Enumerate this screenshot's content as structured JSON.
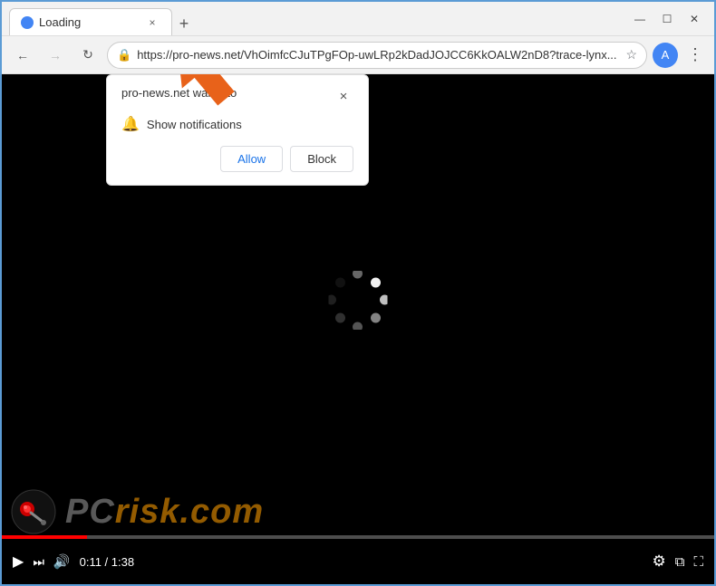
{
  "browser": {
    "title": "Loading",
    "tab_close": "×",
    "new_tab": "+",
    "window_minimize": "—",
    "window_maximize": "☐",
    "window_close": "✕"
  },
  "nav": {
    "back": "←",
    "forward": "→",
    "refresh": "↻",
    "url": "https://pro-news.net/VhOimfcCJuTPgFOp-uwLRp2kDadJOJCC6KkOALW2nD8?trace-lynx...",
    "star": "☆",
    "profile_letter": "A",
    "menu": "⋮"
  },
  "popup": {
    "title": "pro-news.net wants to",
    "close": "×",
    "notification_text": "Show notifications",
    "allow_label": "Allow",
    "block_label": "Block"
  },
  "video": {
    "time_current": "0:11",
    "time_total": "1:38",
    "time_display": "0:11 / 1:38",
    "progress_percent": 12
  },
  "pcrisk": {
    "text_pc": "PC",
    "text_risk": "risk.com"
  },
  "spinner": {
    "dots": [
      {
        "angle": 0,
        "opacity": 1.0,
        "color": "#ffffff"
      },
      {
        "angle": 45,
        "opacity": 0.85,
        "color": "#dddddd"
      },
      {
        "angle": 90,
        "opacity": 0.7,
        "color": "#bbbbbb"
      },
      {
        "angle": 135,
        "opacity": 0.55,
        "color": "#999999"
      },
      {
        "angle": 180,
        "opacity": 0.4,
        "color": "#777777"
      },
      {
        "angle": 225,
        "opacity": 0.3,
        "color": "#666666"
      },
      {
        "angle": 270,
        "opacity": 0.2,
        "color": "#555555"
      },
      {
        "angle": 315,
        "opacity": 0.15,
        "color": "#444444"
      }
    ]
  }
}
